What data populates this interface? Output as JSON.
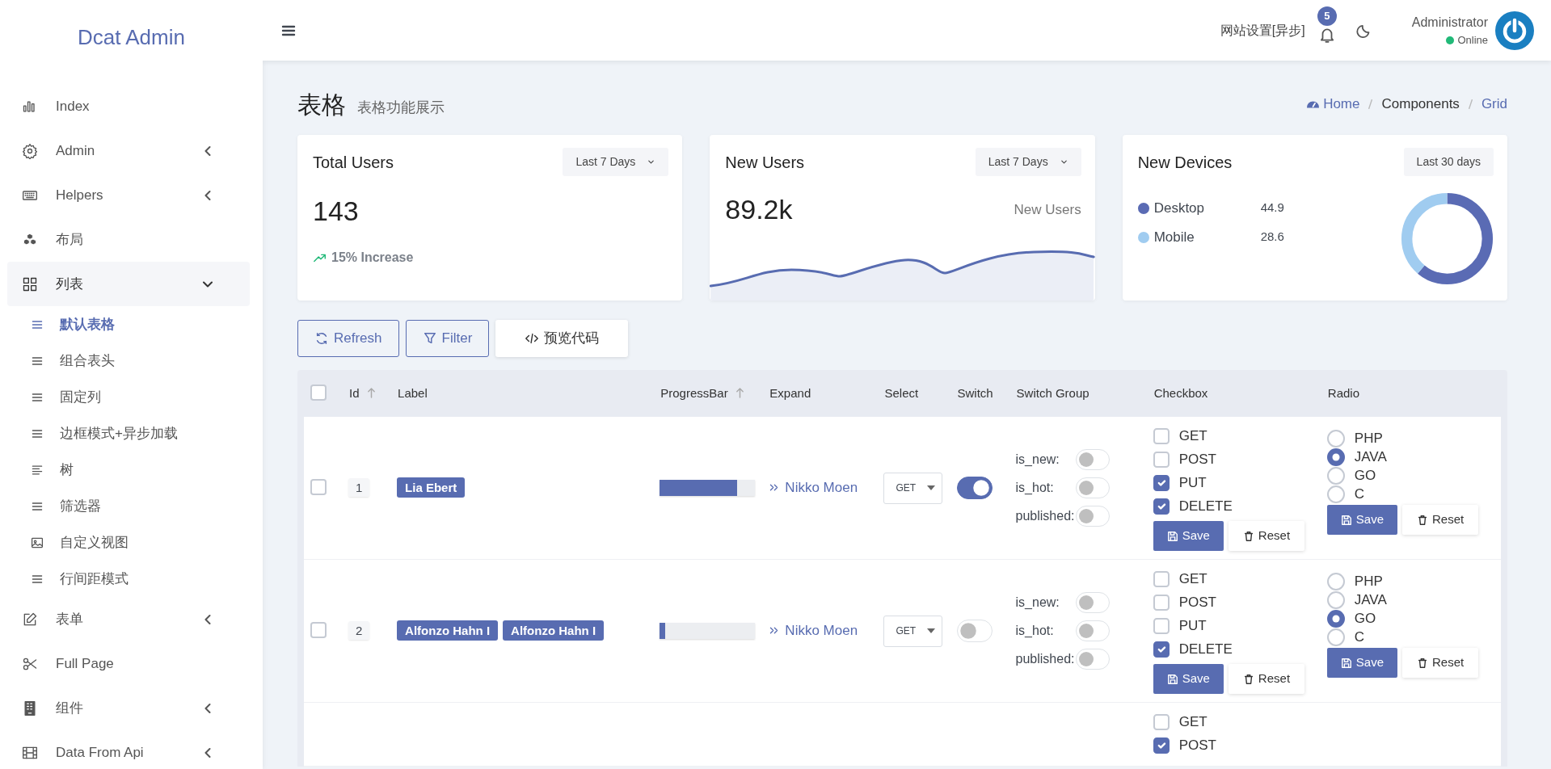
{
  "brand": "Dcat Admin",
  "sidebar": {
    "items": [
      {
        "label": "Index",
        "selected": false
      },
      {
        "label": "Admin",
        "selected": false,
        "expanded": false
      },
      {
        "label": "Helpers",
        "selected": false,
        "expanded": false
      },
      {
        "label": "布局",
        "selected": false
      },
      {
        "label": "列表",
        "selected": true,
        "expanded": true,
        "children": [
          {
            "label": "默认表格",
            "selected": true
          },
          {
            "label": "组合表头",
            "selected": false
          },
          {
            "label": "固定列",
            "selected": false
          },
          {
            "label": "边框模式+异步加载",
            "selected": false
          },
          {
            "label": "树",
            "selected": false
          },
          {
            "label": "筛选器",
            "selected": false
          },
          {
            "label": "自定义视图",
            "selected": false
          },
          {
            "label": "行间距模式",
            "selected": false
          }
        ]
      },
      {
        "label": "表单",
        "selected": false,
        "expanded": false
      },
      {
        "label": "Full Page",
        "selected": false
      },
      {
        "label": "组件",
        "selected": false,
        "expanded": false
      },
      {
        "label": "Data From Api",
        "selected": false,
        "expanded": false
      }
    ]
  },
  "navbar": {
    "menu_link": "网站设置[异步]",
    "notification_count": "5",
    "user": {
      "name": "Administrator",
      "status": "Online"
    }
  },
  "page": {
    "title": "表格",
    "subtitle": "表格功能展示",
    "breadcrumb": [
      {
        "label": "Home"
      },
      {
        "label": "Components"
      },
      {
        "label": "Grid"
      }
    ]
  },
  "cards": [
    {
      "kind": "total",
      "title": "Total Users",
      "range": "Last 7 Days",
      "has_caret": true,
      "value": "143",
      "trend": "15% Increase"
    },
    {
      "kind": "line",
      "title": "New Users",
      "range": "Last 7 Days",
      "has_caret": true,
      "value": "89.2k",
      "caption": "New Users"
    },
    {
      "kind": "donut",
      "title": "New Devices",
      "range": "Last 30 days",
      "has_caret": false,
      "legend": [
        {
          "label": "Desktop",
          "value": "44.9",
          "color": "#5a6bb4"
        },
        {
          "label": "Mobile",
          "value": "28.6",
          "color": "#a0ccf0"
        }
      ]
    }
  ],
  "toolbar": [
    {
      "label": "Refresh",
      "kind": "refresh"
    },
    {
      "label": "Filter",
      "kind": "filter"
    },
    {
      "label": "预览代码",
      "kind": "code"
    }
  ],
  "table": {
    "select_all_checked": false,
    "columns": [
      {
        "label": "Id",
        "sortable": true
      },
      {
        "label": "Label",
        "sortable": false
      },
      {
        "label": "ProgressBar",
        "sortable": true
      },
      {
        "label": "Expand",
        "sortable": false
      },
      {
        "label": "Select",
        "sortable": false
      },
      {
        "label": "Switch",
        "sortable": false
      },
      {
        "label": "Switch Group",
        "sortable": false
      },
      {
        "label": "Checkbox",
        "sortable": false
      },
      {
        "label": "Radio",
        "sortable": false
      }
    ],
    "rows": [
      {
        "selected": false,
        "id": "1",
        "labels": [
          "Lia Ebert"
        ],
        "level": 0.81,
        "expand": "Nikko Moen",
        "select": "GET",
        "switch_on": true,
        "switch_group": [
          {
            "label": "is_new:",
            "on": false
          },
          {
            "label": "is_hot:",
            "on": false
          },
          {
            "label": "published:",
            "on": false
          }
        ],
        "checkbox": [
          {
            "label": "GET",
            "checked": false
          },
          {
            "label": "POST",
            "checked": false
          },
          {
            "label": "PUT",
            "checked": true
          },
          {
            "label": "DELETE",
            "checked": true
          }
        ],
        "checkbox_buttons": [
          "Save",
          "Reset"
        ],
        "radio": [
          {
            "label": "PHP",
            "selected": false
          },
          {
            "label": "JAVA",
            "selected": true
          },
          {
            "label": "GO",
            "selected": false
          },
          {
            "label": "C",
            "selected": false
          }
        ],
        "radio_buttons": [
          "Save",
          "Reset"
        ]
      },
      {
        "selected": false,
        "id": "2",
        "labels": [
          "Alfonzo Hahn I",
          "Alfonzo Hahn I"
        ],
        "level": 0.06,
        "expand": "Nikko Moen",
        "select": "GET",
        "switch_on": false,
        "switch_group": [
          {
            "label": "is_new:",
            "on": false
          },
          {
            "label": "is_hot:",
            "on": false
          },
          {
            "label": "published:",
            "on": false
          }
        ],
        "checkbox": [
          {
            "label": "GET",
            "checked": false
          },
          {
            "label": "POST",
            "checked": false
          },
          {
            "label": "PUT",
            "checked": false
          },
          {
            "label": "DELETE",
            "checked": true
          }
        ],
        "checkbox_buttons": [
          "Save",
          "Reset"
        ],
        "radio": [
          {
            "label": "PHP",
            "selected": false
          },
          {
            "label": "JAVA",
            "selected": false
          },
          {
            "label": "GO",
            "selected": true
          },
          {
            "label": "C",
            "selected": false
          }
        ],
        "radio_buttons": [
          "Save",
          "Reset"
        ]
      },
      {
        "checkbox": [
          {
            "label": "GET",
            "checked": false
          },
          {
            "label": "POST",
            "checked": true
          }
        ]
      }
    ]
  }
}
